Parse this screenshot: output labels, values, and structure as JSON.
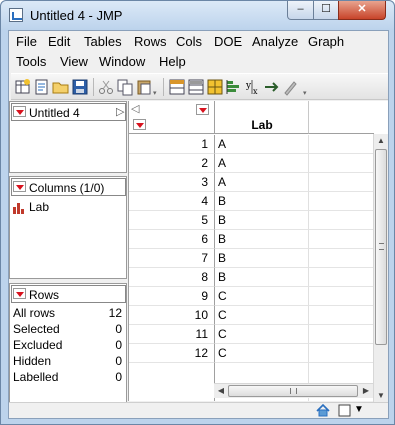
{
  "window": {
    "title": "Untitled 4 - JMP",
    "minimize_glyph": "–",
    "maximize_glyph": "☐",
    "close_glyph": "✕"
  },
  "menu": {
    "row1": [
      "File",
      "Edit",
      "Tables",
      "Rows",
      "Cols",
      "DOE",
      "Analyze",
      "Graph"
    ],
    "row2": [
      "Tools",
      "View",
      "Window",
      "Help"
    ]
  },
  "toolbar": {
    "icons": [
      "new-data-table-icon",
      "new-script-icon",
      "open-icon",
      "save-icon",
      "cut-icon",
      "copy-icon",
      "paste-icon",
      "data-table-list-icon",
      "graph-builder-icon",
      "table-icon",
      "distribution-icon",
      "fit-y-by-x-icon",
      "fit-model-icon",
      "script-editor-icon"
    ]
  },
  "panels": {
    "table": {
      "title": "Untitled 4"
    },
    "columns": {
      "title": "Columns (1/0)",
      "items": [
        {
          "name": "Lab",
          "icon": "nominal-column-icon"
        }
      ]
    },
    "rows": {
      "title": "Rows",
      "items": [
        {
          "label": "All rows",
          "value": "12"
        },
        {
          "label": "Selected",
          "value": "0"
        },
        {
          "label": "Excluded",
          "value": "0"
        },
        {
          "label": "Hidden",
          "value": "0"
        },
        {
          "label": "Labelled",
          "value": "0"
        }
      ]
    }
  },
  "grid": {
    "column_header": "Lab",
    "rows": [
      {
        "n": "1",
        "lab": "A"
      },
      {
        "n": "2",
        "lab": "A"
      },
      {
        "n": "3",
        "lab": "A"
      },
      {
        "n": "4",
        "lab": "B"
      },
      {
        "n": "5",
        "lab": "B"
      },
      {
        "n": "6",
        "lab": "B"
      },
      {
        "n": "7",
        "lab": "B"
      },
      {
        "n": "8",
        "lab": "B"
      },
      {
        "n": "9",
        "lab": "C"
      },
      {
        "n": "10",
        "lab": "C"
      },
      {
        "n": "11",
        "lab": "C"
      },
      {
        "n": "12",
        "lab": "C"
      }
    ]
  },
  "status": {
    "icons": [
      "home-icon",
      "window-list-icon",
      "dropdown-icon"
    ]
  },
  "colors": {
    "red_triangle": "#d8121e",
    "title_bar": "#bcd3ec",
    "close_button": "#c7442a"
  }
}
